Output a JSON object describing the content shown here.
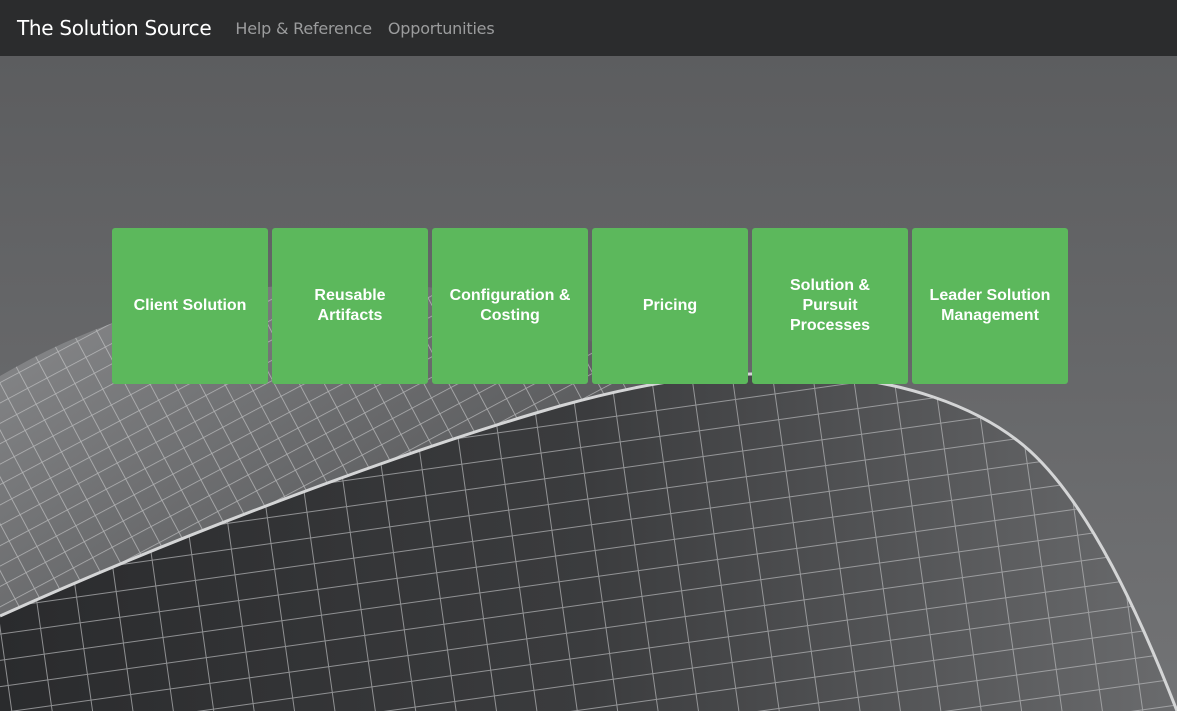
{
  "navbar": {
    "brand": "The Solution Source",
    "links": [
      "Help & Reference",
      "Opportunities"
    ]
  },
  "tiles": [
    "Client Solution",
    "Reusable Artifacts",
    "Configuration & Costing",
    "Pricing",
    "Solution & Pursuit Processes",
    "Leader Solution Management"
  ],
  "colors": {
    "navbar_bg": "#2b2c2d",
    "tile_bg": "#5cb85c",
    "tile_text": "#ffffff",
    "brand_text": "#ffffff",
    "link_text": "#9b9c9d"
  }
}
